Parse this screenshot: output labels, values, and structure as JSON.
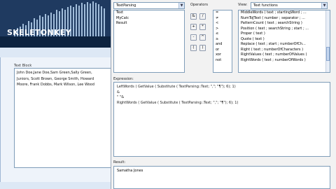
{
  "left": {
    "logo_text": "SKELETONKEY",
    "text_block_label": "Text Block",
    "text_block_lines": [
      "John Doe,Jane Doe,Sam Green,Sally Green,",
      "Juniors, Scott Brown, George Smith, Howard",
      "Moore, Frank Dobbs, Mark Wilson, Lee Wood"
    ]
  },
  "dialog": {
    "source_select": "TextParsing",
    "source_items": [
      "Text",
      "MyCalc",
      "Result"
    ],
    "operators_label": "Operators",
    "operator_buttons": [
      "&",
      "/",
      "+",
      "*",
      "-",
      "^",
      "(",
      ")"
    ],
    "operator_list": [
      "=",
      "≠",
      "<",
      ">",
      "≤",
      "≥",
      "and",
      "or",
      "xor",
      "not"
    ],
    "view_label": "View:",
    "view_select": "Text functions",
    "functions": [
      "MiddleWords ( text ; startingWord ; ...",
      "NumToJText ( number ; separator ; ...",
      "PatternCount ( text ; searchString )",
      "Position ( text ; searchString ; start ; ...",
      "Proper ( text )",
      "Quote ( text )",
      "Replace ( text ; start ; numberOfCh...",
      "Right ( text ; numberOfCharacters )",
      "RightValues ( text ; numberOfValues )",
      "RightWords ( text ; numberOfWords )"
    ],
    "expression_label": "Expression:",
    "expression_lines": [
      "LeftWords ( GetValue ( Substitute ( TextParsing::Text; \",\"; \"¶\"); 6); 1)",
      "&",
      "\" \"&",
      "RightWords ( GetValue ( Substitute ( TextParsing::Text; \",\"; \"¶\"); 6); 1)"
    ],
    "result_label": "Result:",
    "result_value": "Samatha Jones"
  }
}
